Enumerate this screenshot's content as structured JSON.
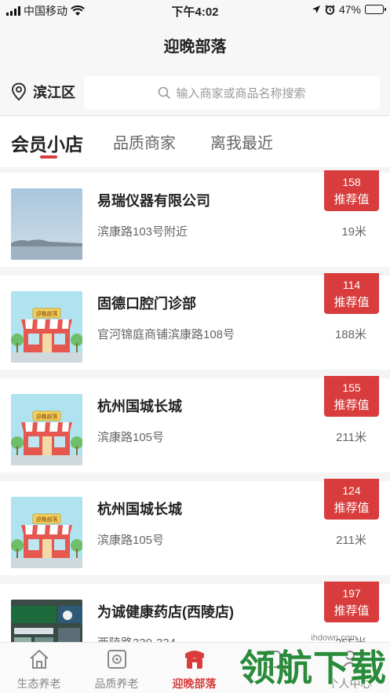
{
  "status_bar": {
    "carrier": "中国移动",
    "time": "下午4:02",
    "battery": "47%",
    "battery_level": 0.47
  },
  "header": {
    "title": "迎晚部落"
  },
  "location": {
    "label": "滨江区",
    "icon": "location-pin-icon"
  },
  "search": {
    "placeholder": "输入商家或商品名称搜索"
  },
  "tabs": [
    {
      "label": "会员小店",
      "active": true
    },
    {
      "label": "品质商家",
      "active": false
    },
    {
      "label": "离我最近",
      "active": false
    }
  ],
  "stores": [
    {
      "name": "易瑞仪器有限公司",
      "address": "滨康路103号附近",
      "distance": "19米",
      "score": "158",
      "score_label": "推荐值",
      "image": "landscape"
    },
    {
      "name": "固德口腔门诊部",
      "address": "官河锦庭商铺滨康路108号",
      "distance": "188米",
      "score": "114",
      "score_label": "推荐值",
      "image": "shop"
    },
    {
      "name": "杭州国城长城",
      "address": "滨康路105号",
      "distance": "211米",
      "score": "155",
      "score_label": "推荐值",
      "image": "shop"
    },
    {
      "name": "杭州国城长城",
      "address": "滨康路105号",
      "distance": "211米",
      "score": "124",
      "score_label": "推荐值",
      "image": "shop"
    },
    {
      "name": "为诚健康药店(西陵店)",
      "address": "西陵路330-334",
      "distance": "255米",
      "score": "197",
      "score_label": "推荐值",
      "image": "pharmacy"
    }
  ],
  "shop_sign": "迎晚部落",
  "tabbar": [
    {
      "label": "生态养老",
      "icon": "house-icon",
      "active": false
    },
    {
      "label": "品质养老",
      "icon": "coupon-icon",
      "active": false
    },
    {
      "label": "迎晚部落",
      "icon": "store-icon",
      "active": true
    },
    {
      "label": "",
      "icon": "tab-icon",
      "active": false
    },
    {
      "label": "个人中心",
      "icon": "person-icon",
      "active": false
    }
  ],
  "watermark": {
    "site": "ihdown.com",
    "text": "领航下载"
  },
  "colors": {
    "accent": "#d83c3c",
    "background": "#f4f4f4"
  }
}
